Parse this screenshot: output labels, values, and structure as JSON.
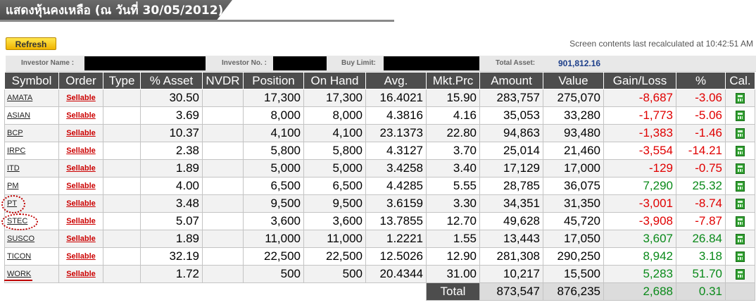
{
  "title": "แสดงหุ้นคงเหลือ (ณ วันที่ 30/05/2012)",
  "refresh_label": "Refresh",
  "recalc_text": "Screen contents last recalculated at 10:42:51 AM",
  "info": {
    "investor_name_label": "Investor Name :",
    "investor_no_label": "Investor No. :",
    "buy_limit_label": "Buy Limit:",
    "total_asset_label": "Total Asset:",
    "total_asset_value": "901,812.16"
  },
  "columns": [
    "Symbol",
    "Order",
    "Type",
    "% Asset",
    "NVDR",
    "Position",
    "On Hand",
    "Avg.",
    "Mkt.Prc",
    "Amount",
    "Value",
    "Gain/Loss",
    "%",
    "Cal."
  ],
  "colors": {
    "header_bg": "#4d4d4d",
    "negative": "#e00000",
    "positive": "#0a8a1a",
    "link_red": "#cc0000",
    "button": "#f0b400"
  },
  "rows": [
    {
      "symbol": "AMATA",
      "order": "Sellable",
      "type": "",
      "asset": "30.50",
      "nvdr": "",
      "position": "17,300",
      "onhand": "17,300",
      "avg": "16.4021",
      "mkt": "15.90",
      "amount": "283,757",
      "value": "275,070",
      "gain": "-8,687",
      "pct": "-3.06"
    },
    {
      "symbol": "ASIAN",
      "order": "Sellable",
      "type": "",
      "asset": "3.69",
      "nvdr": "",
      "position": "8,000",
      "onhand": "8,000",
      "avg": "4.3816",
      "mkt": "4.16",
      "amount": "35,053",
      "value": "33,280",
      "gain": "-1,773",
      "pct": "-5.06"
    },
    {
      "symbol": "BCP",
      "order": "Sellable",
      "type": "",
      "asset": "10.37",
      "nvdr": "",
      "position": "4,100",
      "onhand": "4,100",
      "avg": "23.1373",
      "mkt": "22.80",
      "amount": "94,863",
      "value": "93,480",
      "gain": "-1,383",
      "pct": "-1.46"
    },
    {
      "symbol": "IRPC",
      "order": "Sellable",
      "type": "",
      "asset": "2.38",
      "nvdr": "",
      "position": "5,800",
      "onhand": "5,800",
      "avg": "4.3127",
      "mkt": "3.70",
      "amount": "25,014",
      "value": "21,460",
      "gain": "-3,554",
      "pct": "-14.21"
    },
    {
      "symbol": "ITD",
      "order": "Sellable",
      "type": "",
      "asset": "1.89",
      "nvdr": "",
      "position": "5,000",
      "onhand": "5,000",
      "avg": "3.4258",
      "mkt": "3.40",
      "amount": "17,129",
      "value": "17,000",
      "gain": "-129",
      "pct": "-0.75"
    },
    {
      "symbol": "PM",
      "order": "Sellable",
      "type": "",
      "asset": "4.00",
      "nvdr": "",
      "position": "6,500",
      "onhand": "6,500",
      "avg": "4.4285",
      "mkt": "5.55",
      "amount": "28,785",
      "value": "36,075",
      "gain": "7,290",
      "pct": "25.32"
    },
    {
      "symbol": "PT",
      "order": "Sellable",
      "type": "",
      "asset": "3.48",
      "nvdr": "",
      "position": "9,500",
      "onhand": "9,500",
      "avg": "3.6159",
      "mkt": "3.30",
      "amount": "34,351",
      "value": "31,350",
      "gain": "-3,001",
      "pct": "-8.74"
    },
    {
      "symbol": "STEC",
      "order": "Sellable",
      "type": "",
      "asset": "5.07",
      "nvdr": "",
      "position": "3,600",
      "onhand": "3,600",
      "avg": "13.7855",
      "mkt": "12.70",
      "amount": "49,628",
      "value": "45,720",
      "gain": "-3,908",
      "pct": "-7.87"
    },
    {
      "symbol": "SUSCO",
      "order": "Sellable",
      "type": "",
      "asset": "1.89",
      "nvdr": "",
      "position": "11,000",
      "onhand": "11,000",
      "avg": "1.2221",
      "mkt": "1.55",
      "amount": "13,443",
      "value": "17,050",
      "gain": "3,607",
      "pct": "26.84"
    },
    {
      "symbol": "TICON",
      "order": "Sellable",
      "type": "",
      "asset": "32.19",
      "nvdr": "",
      "position": "22,500",
      "onhand": "22,500",
      "avg": "12.5026",
      "mkt": "12.90",
      "amount": "281,308",
      "value": "290,250",
      "gain": "8,942",
      "pct": "3.18"
    },
    {
      "symbol": "WORK",
      "order": "Sellable",
      "type": "",
      "asset": "1.72",
      "nvdr": "",
      "position": "500",
      "onhand": "500",
      "avg": "20.4344",
      "mkt": "31.00",
      "amount": "10,217",
      "value": "15,500",
      "gain": "5,283",
      "pct": "51.70"
    }
  ],
  "total": {
    "label": "Total",
    "amount": "873,547",
    "value": "876,235",
    "gain": "2,688",
    "pct": "0.31"
  }
}
